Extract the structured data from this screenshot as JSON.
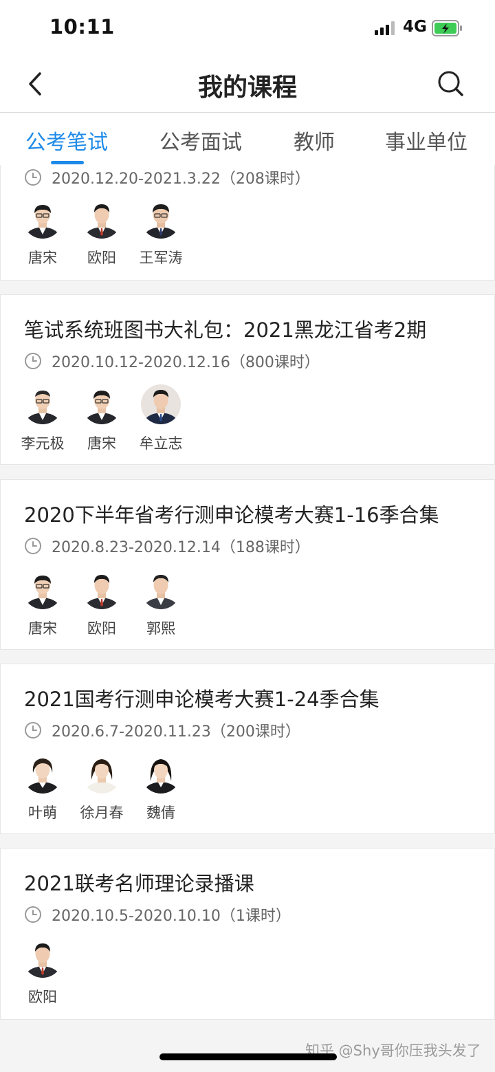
{
  "status_bar": {
    "time": "10:11",
    "network": "4G",
    "battery_color": "#3ecb56"
  },
  "nav": {
    "title": "我的课程",
    "back_icon": "chevron-left-icon",
    "search_icon": "search-icon"
  },
  "tabs": [
    {
      "label": "公考笔试",
      "active": true
    },
    {
      "label": "公考面试",
      "active": false
    },
    {
      "label": "教师",
      "active": false
    },
    {
      "label": "事业单位",
      "active": false
    }
  ],
  "accent_color": "#1e8ae8",
  "courses": [
    {
      "title": "",
      "date": "2020.12.20-2021.3.22（208课时）",
      "teachers": [
        {
          "name": "唐宋"
        },
        {
          "name": "欧阳"
        },
        {
          "name": "王军涛"
        }
      ]
    },
    {
      "title": "笔试系统班图书大礼包：2021黑龙江省考2期",
      "date": "2020.10.12-2020.12.16（800课时）",
      "teachers": [
        {
          "name": "李元极"
        },
        {
          "name": "唐宋"
        },
        {
          "name": "牟立志"
        }
      ]
    },
    {
      "title": "2020下半年省考行测申论模考大赛1-16季合集",
      "date": "2020.8.23-2020.12.14（188课时）",
      "teachers": [
        {
          "name": "唐宋"
        },
        {
          "name": "欧阳"
        },
        {
          "name": "郭熙"
        }
      ]
    },
    {
      "title": "2021国考行测申论模考大赛1-24季合集",
      "date": "2020.6.7-2020.11.23（200课时）",
      "teachers": [
        {
          "name": "叶萌"
        },
        {
          "name": "徐月春"
        },
        {
          "name": "魏倩"
        }
      ]
    },
    {
      "title": "2021联考名师理论录播课",
      "date": "2020.10.5-2020.10.10（1课时）",
      "teachers": [
        {
          "name": "欧阳"
        }
      ]
    }
  ],
  "watermark": "知乎 @Shy哥你压我头发了"
}
